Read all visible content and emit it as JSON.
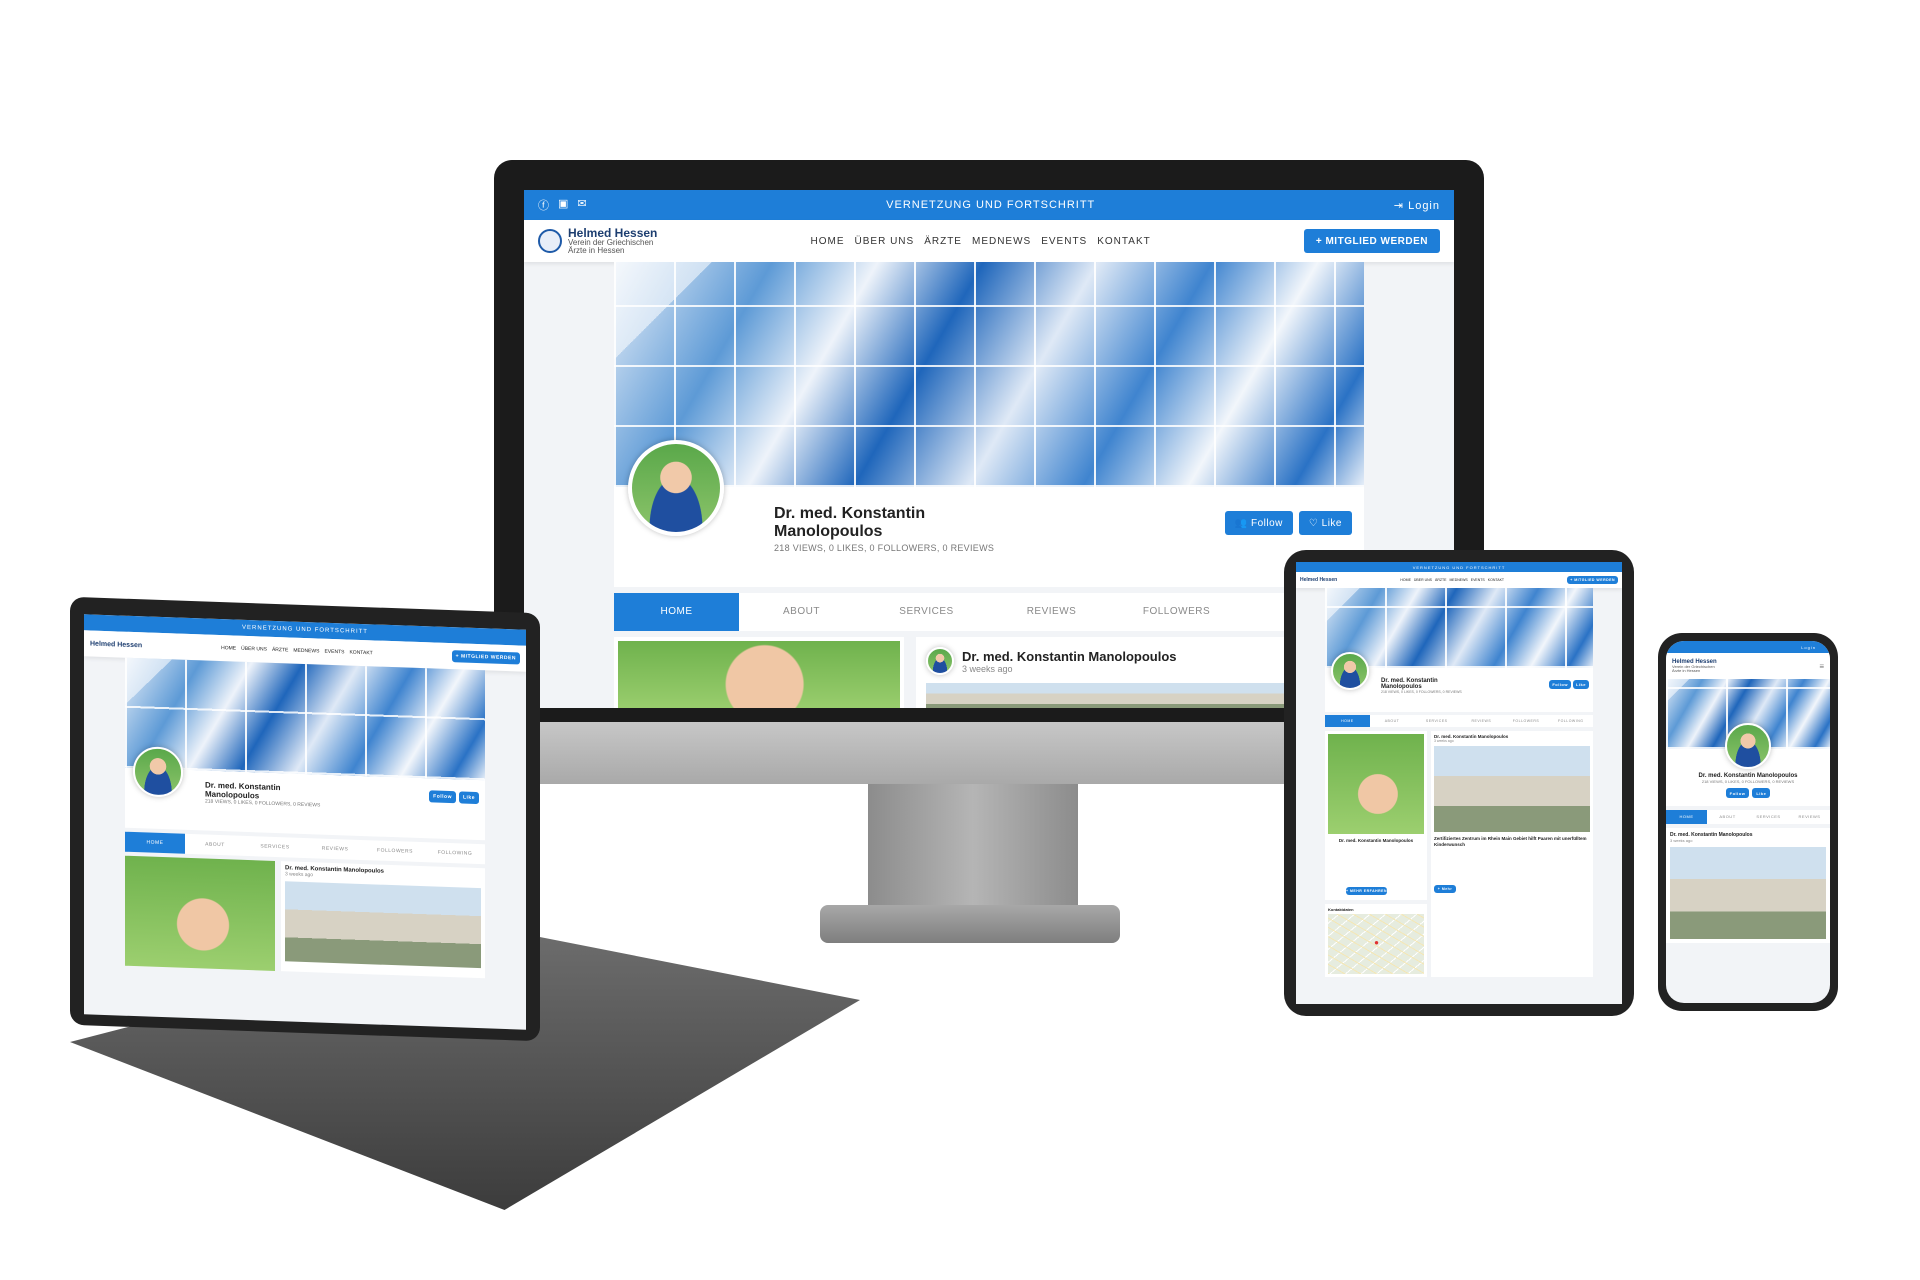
{
  "site": {
    "topbar_text": "VERNETZUNG UND FORTSCHRITT",
    "login_label": "Login",
    "logo_title": "Helmed Hessen",
    "logo_subtitle_1": "Verein der Griechischen",
    "logo_subtitle_2": "Ärzte in Hessen",
    "nav": [
      "HOME",
      "ÜBER UNS",
      "ÄRZTE",
      "MEDNEWS",
      "EVENTS",
      "KONTAKT"
    ],
    "cta_label": "+ MITGLIED WERDEN",
    "accent_color": "#1e7ed8"
  },
  "profile": {
    "name_line_1": "Dr. med. Konstantin",
    "name_line_2": "Manolopoulos",
    "name_full": "Dr. med. Konstantin Manolopoulos",
    "stats": "218 VIEWS, 0 LIKES, 0 FOLLOWERS, 0 REVIEWS",
    "follow_label": "Follow",
    "like_label": "Like",
    "tabs": [
      "HOME",
      "ABOUT",
      "SERVICES",
      "REVIEWS",
      "FOLLOWERS",
      "FOLLOWING"
    ],
    "tabs_desktop": [
      "HOME",
      "ABOUT",
      "SERVICES",
      "REVIEWS",
      "FOLLOWERS",
      "FOL"
    ],
    "post_author": "Dr. med. Konstantin Manolopoulos",
    "post_time": "3 weeks ago"
  },
  "tablet_post": {
    "headline": "Zertifiziertes Zentrum im Rhein Main Gebiet hilft Paaren mit unerfülltem Kinderwunsch",
    "more_button": "+ MEHR ERFAHREN",
    "map_label": "Kontaktdaten",
    "read_more": "+ Mehr"
  },
  "icons": [
    "facebook-icon",
    "linkedin-icon",
    "mail-icon",
    "login-icon",
    "plus-icon",
    "users-icon",
    "heart-icon",
    "menu-icon"
  ]
}
